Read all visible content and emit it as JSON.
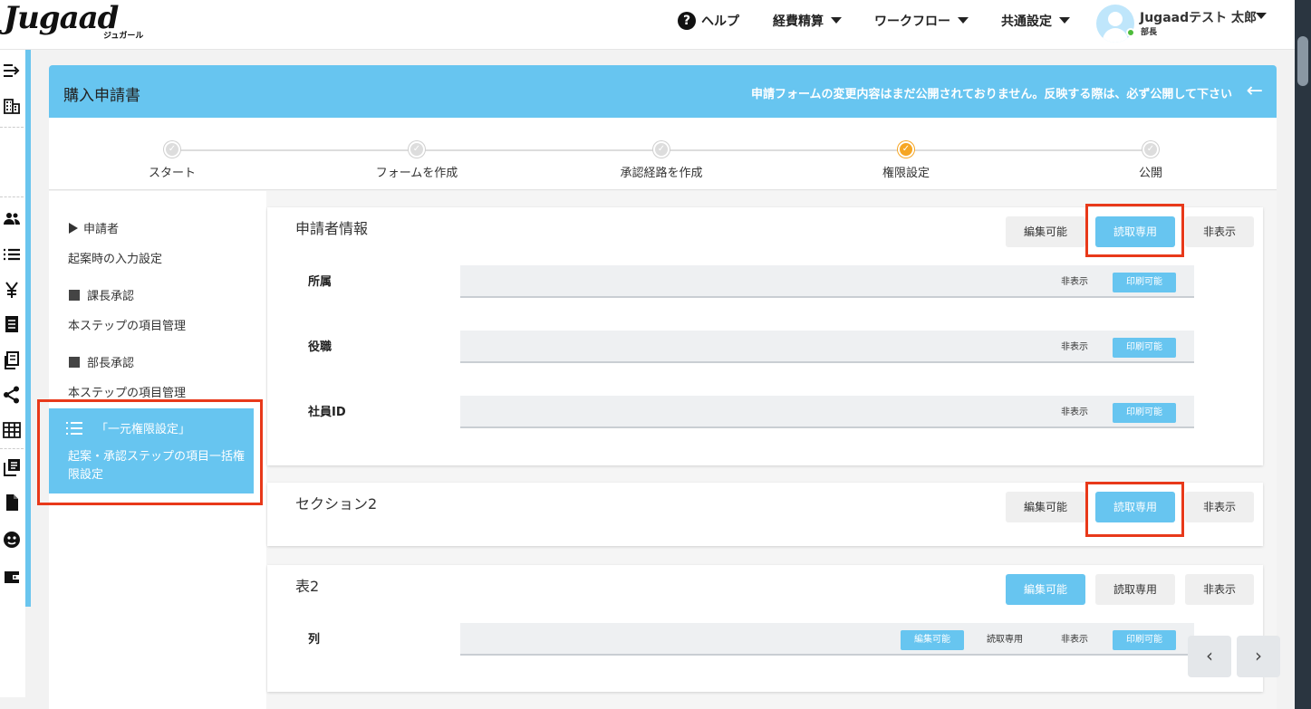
{
  "brand": {
    "name": "Jugaad",
    "sub": "ジュガール"
  },
  "topnav": {
    "help": "ヘルプ",
    "expense": "経費精算",
    "workflow": "ワークフロー",
    "common": "共通設定",
    "user_name": "Jugaadテスト 太郎",
    "user_role": "部長"
  },
  "page": {
    "title": "購入申請書",
    "notice": "申請フォームの変更内容はまだ公開されておりません。反映する際は、必ず公開して下さい"
  },
  "steps": [
    "スタート",
    "フォームを作成",
    "承認経路を作成",
    "権限設定",
    "公開"
  ],
  "active_step": 3,
  "menu": {
    "applicant": "申請者",
    "applicant_sub": "起案時の入力設定",
    "section_manager": "課長承認",
    "section_manager_sub": "本ステップの項目管理",
    "dept_manager": "部長承認",
    "dept_manager_sub": "本ステップの項目管理",
    "unified_title": "「一元権限設定」",
    "unified_desc": "起案・承認ステップの項目一括権限設定"
  },
  "perm": {
    "edit": "編集可能",
    "readonly": "読取専用",
    "hidden": "非表示",
    "print": "印刷可能"
  },
  "sections": [
    {
      "title": "申請者情報",
      "selected": "読取専用",
      "fields": [
        "所属",
        "役職",
        "社員ID"
      ]
    },
    {
      "title": "セクション2",
      "selected": "読取専用",
      "fields": []
    },
    {
      "title": "表2",
      "selected": "編集可能",
      "fields": [
        "列"
      ]
    }
  ],
  "pager": {
    "prev": "‹",
    "next": "›"
  },
  "colors": {
    "accent": "#67c5f0",
    "highlight": "#e8391a",
    "active_step": "#f6a623"
  }
}
